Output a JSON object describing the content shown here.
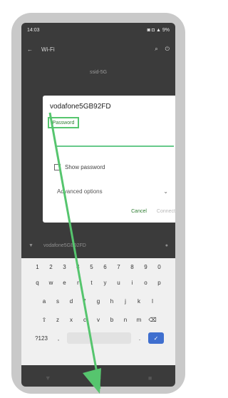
{
  "status": {
    "time": "14:03",
    "right": "◙ ◘ ▲ 9%"
  },
  "appbar": {
    "back": "←",
    "title": "Wi-Fi",
    "search": "⌕",
    "menu": "⏻"
  },
  "network": {
    "current": "ssid-5G"
  },
  "dialog": {
    "title": "vodafone5GB92FD",
    "password_label": "Password",
    "show_password": "Show password",
    "advanced": "Advanced options",
    "cancel": "Cancel",
    "connect": "Connect"
  },
  "lower": {
    "label": "vodafone5GB92FD"
  },
  "keyboard": {
    "digits": [
      "1",
      "2",
      "3",
      "4",
      "5",
      "6",
      "7",
      "8",
      "9",
      "0"
    ],
    "row1": [
      "q",
      "w",
      "e",
      "r",
      "t",
      "y",
      "u",
      "i",
      "o",
      "p"
    ],
    "row2": [
      "a",
      "s",
      "d",
      "f",
      "g",
      "h",
      "j",
      "k",
      "l"
    ],
    "row3": [
      "z",
      "x",
      "c",
      "v",
      "b",
      "n",
      "m"
    ],
    "bottom_left": "?123",
    "comma": ",",
    "period": ".",
    "enter": "✓"
  },
  "nav": {
    "back": "▼",
    "home": "●",
    "recents": "■"
  },
  "colors": {
    "highlight": "#56c56e"
  }
}
